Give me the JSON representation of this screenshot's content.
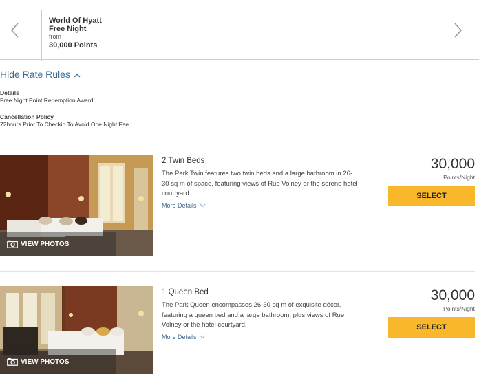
{
  "rate_tab": {
    "name_line1": "World Of Hyatt",
    "name_line2": "Free Night",
    "from_label": "from",
    "price": "30,000 Points"
  },
  "rate_rules": {
    "toggle_label": "Hide Rate Rules",
    "details_heading": "Details",
    "details_text": "Free Night Point Redemption Award.",
    "cancellation_heading": "Cancellation Policy",
    "cancellation_text": "72hours Prior To Checkin To Avoid One Night Fee"
  },
  "rooms": [
    {
      "title": "2 Twin Beds",
      "description": "The Park Twin features two twin beds and a large bathroom in 26-30 sq m of space, featuring views of Rue Volney or the serene hotel courtyard.",
      "more_details": "More Details",
      "view_photos": "VIEW PHOTOS",
      "price": "30,000",
      "price_unit": "Points/Night",
      "select_label": "SELECT"
    },
    {
      "title": "1 Queen Bed",
      "description": "The Park Queen encompasses 26-30 sq m of exquisite décor, featuring a queen bed and a large bathroom, plus views of Rue Volney or the hotel courtyard.",
      "more_details": "More Details",
      "view_photos": "VIEW PHOTOS",
      "price": "30,000",
      "price_unit": "Points/Night",
      "select_label": "SELECT"
    }
  ],
  "colors": {
    "link": "#3d6a93",
    "select_button": "#f9b72b",
    "divider": "#e3e3e3"
  },
  "icons": [
    "chevron-left-icon",
    "chevron-right-icon",
    "chevron-up-icon",
    "chevron-down-icon",
    "camera-icon"
  ]
}
